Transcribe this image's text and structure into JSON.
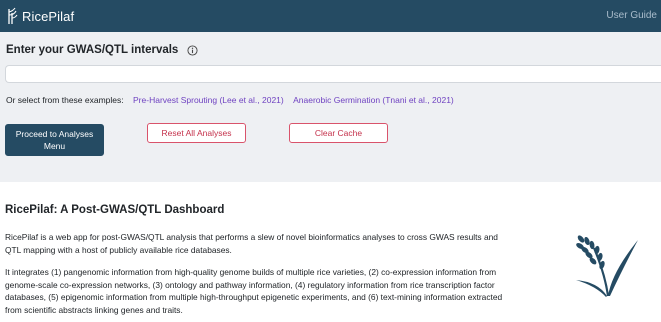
{
  "navbar": {
    "brand": "RicePilaf",
    "user_guide": "User Guide",
    "brand_icon": "ricepilaf-logo-icon",
    "background": "#254b63"
  },
  "search": {
    "label": "Enter your GWAS/QTL intervals",
    "info_icon": "info-circle-icon",
    "input_value": "",
    "examples_prefix": "Or select from these examples:",
    "examples": [
      "Pre-Harvest Sprouting (Lee et al., 2021)",
      "Anaerobic Germination (Tnani et al., 2021)"
    ]
  },
  "buttons": {
    "proceed": "Proceed to Analyses Menu",
    "reset": "Reset All Analyses",
    "clear_cache": "Clear Cache"
  },
  "about": {
    "title": "RicePilaf: A Post-GWAS/QTL Dashboard",
    "paragraph1": "RicePilaf is a web app for post-GWAS/QTL analysis that performs a slew of novel bioinformatics analyses to cross GWAS results and QTL mapping with a host of publicly available rice databases.",
    "paragraph2": "It integrates (1) pangenomic information from high-quality genome builds of multiple rice varieties, (2) co-expression information from genome-scale co-expression networks, (3) ontology and pathway information, (4) regulatory information from rice transcription factor databases, (5) epigenomic information from multiple high-throughput epigenetic experiments, and (6) text-mining information extracted from scientific abstracts linking genes and traits.",
    "illustration_icon": "rice-plant-icon"
  },
  "colors": {
    "primary": "#254b63",
    "danger": "#c4314b",
    "link": "#6f42c1",
    "panel": "#eef0f3"
  }
}
